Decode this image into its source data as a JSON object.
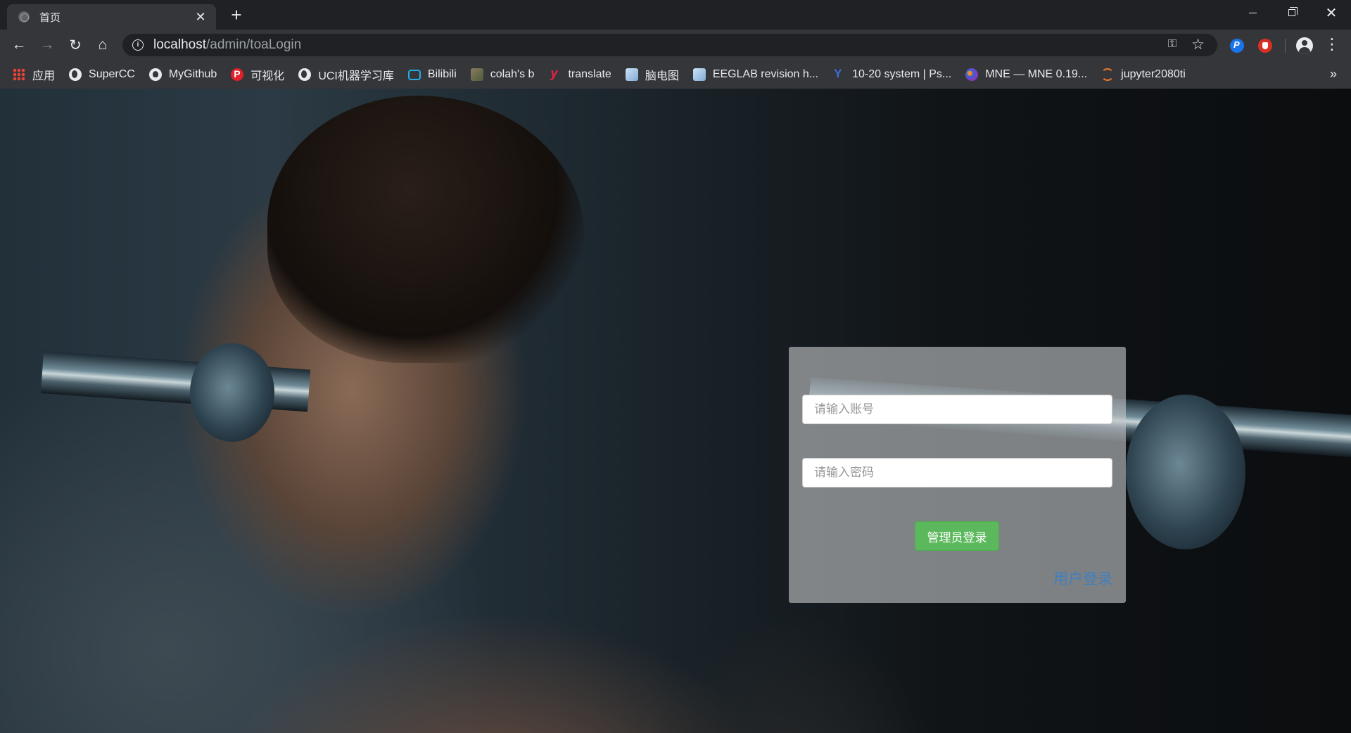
{
  "tab": {
    "title": "首页"
  },
  "toolbar": {
    "url_host": "localhost",
    "url_path": "/admin/toaLogin"
  },
  "bookmarks": [
    {
      "label": "应用",
      "icon": "apps-icon"
    },
    {
      "label": "SuperCC",
      "icon": "globe-icon"
    },
    {
      "label": "MyGithub",
      "icon": "github-icon"
    },
    {
      "label": "可视化",
      "icon": "p-logo-icon"
    },
    {
      "label": "UCI机器学习库",
      "icon": "globe-icon"
    },
    {
      "label": "Bilibili",
      "icon": "bilibili-icon"
    },
    {
      "label": "colah's b",
      "icon": "image-icon"
    },
    {
      "label": "translate",
      "icon": "y-logo-icon"
    },
    {
      "label": "脑电图",
      "icon": "document-icon"
    },
    {
      "label": "EEGLAB revision h...",
      "icon": "document-icon"
    },
    {
      "label": "10-20 system | Ps...",
      "icon": "y-logo-icon"
    },
    {
      "label": "MNE — MNE 0.19...",
      "icon": "mne-icon"
    },
    {
      "label": "jupyter2080ti",
      "icon": "jupyter-icon"
    }
  ],
  "login": {
    "account_placeholder": "请输入账号",
    "password_placeholder": "请输入密码",
    "admin_button": "管理员登录",
    "user_link": "用户登录"
  },
  "colors": {
    "admin_button": "#5cb85c",
    "user_link": "#3f7fc0"
  }
}
